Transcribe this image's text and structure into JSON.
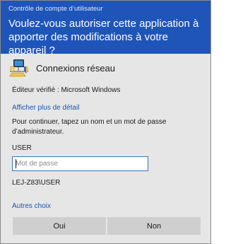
{
  "window": {
    "title": "Contrôle de compte d’utilisateur",
    "prompt": "Voulez-vous autoriser cette application à apporter des modifications à votre appareil ?"
  },
  "app": {
    "name": "Connexions réseau",
    "icon": "network-connections-icon"
  },
  "publisher_text": "Éditeur vérifié : Microsoft Windows",
  "details_link": "Afficher plus de détail",
  "instructions": "Pour continuer, tapez un nom et un mot de passe d’administrateur.",
  "credentials": {
    "user_label": "USER",
    "password_placeholder": "Mot de passe",
    "password_value": "",
    "domain_user": "LEJ-Z83\\USER"
  },
  "more_choices_link": "Autres choix",
  "buttons": {
    "yes": "Oui",
    "no": "Non"
  },
  "colors": {
    "header": "#1f55b8",
    "link": "#1a56b0",
    "body": "#e6e6e6",
    "button": "#cfcfcf"
  }
}
